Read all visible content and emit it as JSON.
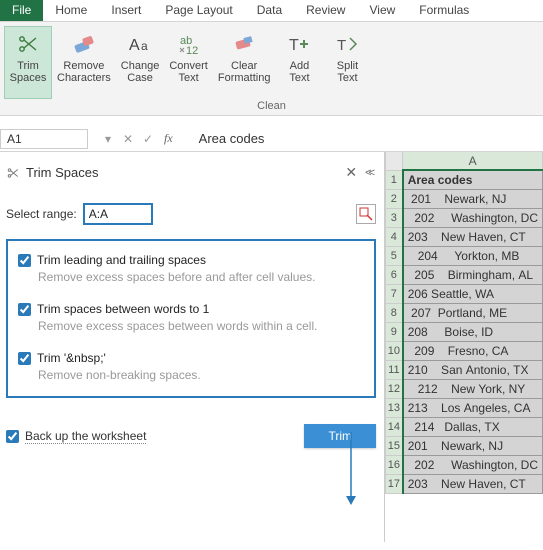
{
  "tabs": [
    "File",
    "Home",
    "Insert",
    "Page Layout",
    "Data",
    "Review",
    "View",
    "Formulas"
  ],
  "ribbon": {
    "buttons": [
      {
        "label": "Trim\nSpaces"
      },
      {
        "label": "Remove\nCharacters"
      },
      {
        "label": "Change\nCase"
      },
      {
        "label": "Convert\nText"
      },
      {
        "label": "Clear\nFormatting"
      },
      {
        "label": "Add\nText"
      },
      {
        "label": "Split\nText"
      }
    ],
    "group_caption": "Clean"
  },
  "namebox": "A1",
  "formula_value": "Area codes",
  "pane": {
    "title": "Trim Spaces",
    "select_label": "Select range:",
    "select_value": "A:A",
    "options": [
      {
        "label": "Trim leading and trailing spaces",
        "desc": "Remove excess spaces before and after cell values."
      },
      {
        "label": "Trim spaces between words to 1",
        "desc": "Remove excess spaces between words within a cell."
      },
      {
        "label": "Trim '&nbsp;'",
        "desc": "Remove non-breaking spaces."
      }
    ],
    "backup": "Back up the worksheet",
    "trim_btn": "Trim"
  },
  "grid": {
    "col": "A",
    "header": "Area codes",
    "rows": [
      " 201    Newark, NJ",
      "  202     Washington, DC",
      "203    New Haven, CT",
      "   204     Yorkton, MB",
      "  205    Birmingham, AL",
      "206 Seattle, WA",
      " 207  Portland, ME",
      "208     Boise, ID",
      "  209    Fresno, CA",
      "210    San Antonio, TX",
      "   212    New York, NY",
      "213    Los Angeles, CA",
      "  214   Dallas, TX",
      "201    Newark, NJ",
      "  202     Washington, DC",
      "203    New Haven, CT"
    ]
  }
}
